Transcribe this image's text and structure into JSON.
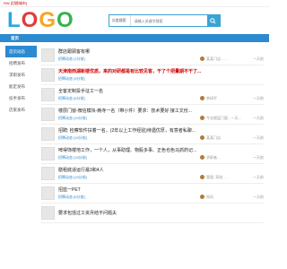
{
  "topbar": {
    "text": "RW [切换城市]"
  },
  "header": {
    "logo": [
      "L",
      "O",
      "G",
      "O"
    ],
    "search_select": "分类搜索",
    "search_placeholder": "请输入关键字搜索"
  },
  "nav": {
    "home": "首页"
  },
  "sidebar": {
    "items": [
      {
        "label": "首页动态",
        "active": true
      },
      {
        "label": "招聘发布",
        "active": false
      },
      {
        "label": "求职发布",
        "active": false
      },
      {
        "label": "能定发布",
        "active": false
      },
      {
        "label": "投手发布",
        "active": false
      },
      {
        "label": "店家发布",
        "active": false
      }
    ]
  },
  "posts": [
    {
      "title": "群店跟顾客有哪",
      "highlight": false,
      "meta": "招聘动态 [1分前]",
      "user": "某某门店 - ...",
      "time": "一天前"
    },
    {
      "title": "天津南西湖新楼优质，来的对研都是有比较见客，干了个把量期不干了...",
      "highlight": true,
      "meta": "招聘动态 [3分前]",
      "user": "",
      "time": ""
    },
    {
      "title": "全客定制投手征工一名",
      "highlight": false,
      "meta": "招聘动态 [5分前]",
      "user": "茶研平",
      "time": "一天前"
    },
    {
      "title": "楼层门窗-微信模块-韩寺一名（带小件）要求：技术要好 接工文份...",
      "highlight": false,
      "meta": "招聘动态 [15分前]",
      "user": "今业楼层门窗 - 一天...",
      "time": "一天前"
    },
    {
      "title": "招聘: 检察软件扶着一名。(2年以上工作经验)待遇优厚，有意者私聊...",
      "highlight": false,
      "meta": "招聘动态 [15分前]",
      "user": "某某门店",
      "time": "一天前"
    },
    {
      "title": "啤得饰楼地工作，一个人，从事助理、物股多事、正色也色马抓药记...",
      "highlight": false,
      "meta": "招聘动态 [15分前]",
      "user": "求职者...",
      "time": "一天前"
    },
    {
      "title": "膳租底适运行最3和4人",
      "highlight": false,
      "meta": "招聘动态 [15分前]",
      "user": "管理, 家纹, ...",
      "time": "一天前"
    },
    {
      "title": "招蓝一PET",
      "highlight": false,
      "meta": "招聘动态 [5分前]",
      "user": "知风",
      "time": "一天前"
    },
    {
      "title": "要求包括过工资月结不问题夫",
      "highlight": false,
      "meta": "",
      "user": "",
      "time": ""
    }
  ],
  "colors": {
    "brand": "#2c8ad0",
    "highlight": "#cc0000"
  }
}
